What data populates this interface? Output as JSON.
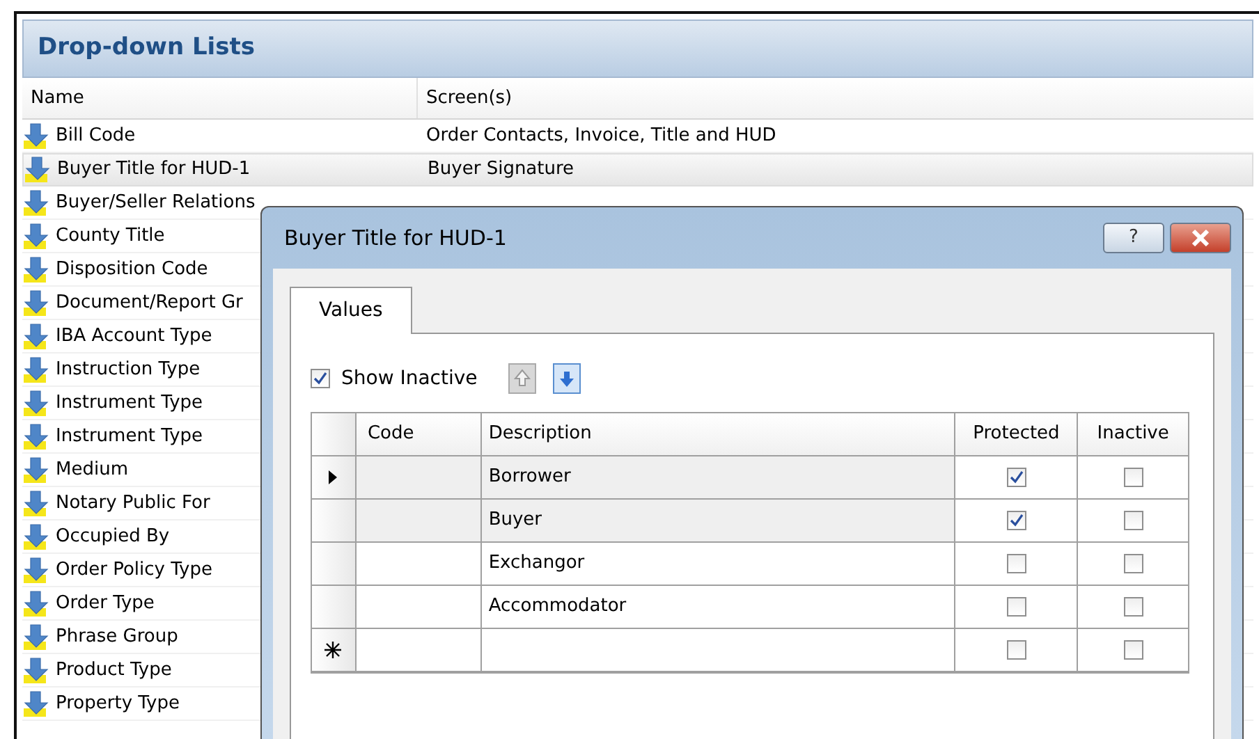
{
  "panel": {
    "title": "Drop-down Lists",
    "columns": [
      "Name",
      "Screen(s)"
    ],
    "rows": [
      {
        "name": "Bill Code",
        "screens": "Order Contacts, Invoice, Title and HUD",
        "selected": false
      },
      {
        "name": "Buyer Title for HUD-1",
        "screens": "Buyer Signature",
        "selected": true
      },
      {
        "name": "Buyer/Seller Relations",
        "selected": false
      },
      {
        "name": "County Title",
        "selected": false
      },
      {
        "name": "Disposition Code",
        "selected": false
      },
      {
        "name": "Document/Report Gr",
        "selected": false
      },
      {
        "name": "IBA Account Type",
        "selected": false
      },
      {
        "name": "Instruction Type",
        "selected": false
      },
      {
        "name": "Instrument Type",
        "selected": false
      },
      {
        "name": "Instrument Type",
        "selected": false
      },
      {
        "name": "Medium",
        "selected": false
      },
      {
        "name": "Notary Public For",
        "selected": false
      },
      {
        "name": "Occupied By",
        "selected": false
      },
      {
        "name": "Order Policy Type",
        "selected": false
      },
      {
        "name": "Order Type",
        "selected": false
      },
      {
        "name": "Phrase Group",
        "selected": false
      },
      {
        "name": "Product Type",
        "selected": false
      },
      {
        "name": "Property Type",
        "selected": false
      }
    ]
  },
  "dialog": {
    "title": "Buyer Title for HUD-1",
    "help": "?",
    "tabs": [
      {
        "label": "Values",
        "selected": true
      }
    ],
    "show_inactive": {
      "label": "Show Inactive",
      "checked": true
    },
    "grid": {
      "columns": [
        "Code",
        "Description",
        "Protected",
        "Inactive"
      ],
      "rows": [
        {
          "kind": "value",
          "current": true,
          "description": "Borrower",
          "protected": true,
          "inactive": false
        },
        {
          "kind": "value",
          "current": false,
          "description": "Buyer",
          "protected": true,
          "inactive": false
        },
        {
          "kind": "value",
          "current": false,
          "description": "Exchangor",
          "protected": false,
          "inactive": false
        },
        {
          "kind": "value",
          "current": false,
          "description": "Accommodator",
          "protected": false,
          "inactive": false
        },
        {
          "kind": "new",
          "current": false,
          "protected": false,
          "inactive": false
        }
      ]
    }
  }
}
